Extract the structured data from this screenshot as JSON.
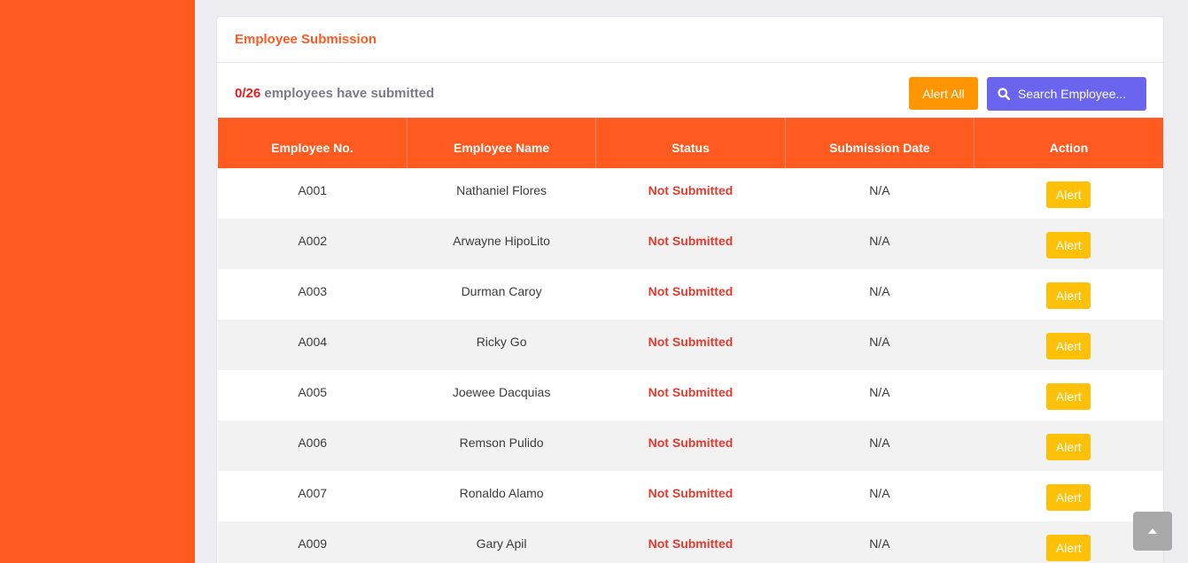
{
  "card": {
    "title": "Employee Submission"
  },
  "summary": {
    "count": "0/26",
    "text": "employees have submitted"
  },
  "toolbar": {
    "alert_all_label": "Alert All",
    "search_label": "Search Employee..."
  },
  "table": {
    "headers": [
      "Employee No.",
      "Employee Name",
      "Status",
      "Submission Date",
      "Action"
    ],
    "rows": [
      {
        "no": "A001",
        "name": "Nathaniel Flores",
        "status": "Not Submitted",
        "date": "N/A",
        "action": "Alert"
      },
      {
        "no": "A002",
        "name": "Arwayne HipoLito",
        "status": "Not Submitted",
        "date": "N/A",
        "action": "Alert"
      },
      {
        "no": "A003",
        "name": "Durman Caroy",
        "status": "Not Submitted",
        "date": "N/A",
        "action": "Alert"
      },
      {
        "no": "A004",
        "name": "Ricky Go",
        "status": "Not Submitted",
        "date": "N/A",
        "action": "Alert"
      },
      {
        "no": "A005",
        "name": "Joewee Dacquias",
        "status": "Not Submitted",
        "date": "N/A",
        "action": "Alert"
      },
      {
        "no": "A006",
        "name": "Remson Pulido",
        "status": "Not Submitted",
        "date": "N/A",
        "action": "Alert"
      },
      {
        "no": "A007",
        "name": "Ronaldo Alamo",
        "status": "Not Submitted",
        "date": "N/A",
        "action": "Alert"
      },
      {
        "no": "A009",
        "name": "Gary Apil",
        "status": "Not Submitted",
        "date": "N/A",
        "action": "Alert"
      }
    ]
  },
  "icons": {
    "search": "search-icon",
    "scroll_top": "chevron-up-icon"
  },
  "colors": {
    "brand": "#ff5a1f",
    "alert_all": "#ff9500",
    "search": "#6a64ef",
    "row_alert": "#ffc107",
    "status_red": "#e23b2e",
    "count_red": "#e21d1d"
  }
}
